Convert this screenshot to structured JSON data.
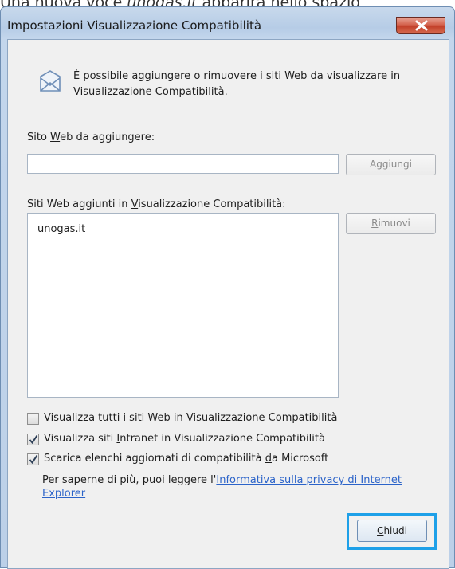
{
  "caption": {
    "prefix": "Una nuova voce ",
    "italic": "unogas.it",
    "suffix": " apparirà nello spazio"
  },
  "window": {
    "title": "Impostazioni Visualizzazione Compatibilità",
    "close_icon": "close-x-icon"
  },
  "info": {
    "icon": "document-compatibility-icon",
    "text": "È possibile aggiungere o rimuovere i siti Web da visualizzare in Visualizzazione Compatibilità."
  },
  "add_section": {
    "label_before": "Sito ",
    "label_accel": "W",
    "label_after": "eb da aggiungere:",
    "input_value": "",
    "add_button": "Aggiungi"
  },
  "list_section": {
    "label_before": "Siti Web aggiunti in ",
    "label_accel": "V",
    "label_after": "isualizzazione Compatibilità:",
    "items": [
      "unogas.it"
    ],
    "remove_accel": "R",
    "remove_rest": "imuovi"
  },
  "options": [
    {
      "before": "Visualizza tutti i siti W",
      "accel": "e",
      "after": "b in Visualizzazione Compatibilità",
      "checked": false
    },
    {
      "before": "Visualizza siti ",
      "accel": "I",
      "after": "ntranet in Visualizzazione Compatibilità",
      "checked": true
    },
    {
      "before": "Scarica elenchi aggiornati di compatibilità ",
      "accel": "d",
      "after": "a Microsoft",
      "checked": true
    }
  ],
  "privacy": {
    "text": "Per saperne di più, puoi leggere l'",
    "link": "Informativa sulla privacy di Internet Explorer"
  },
  "footer": {
    "close_accel": "C",
    "close_rest": "hiudi"
  }
}
